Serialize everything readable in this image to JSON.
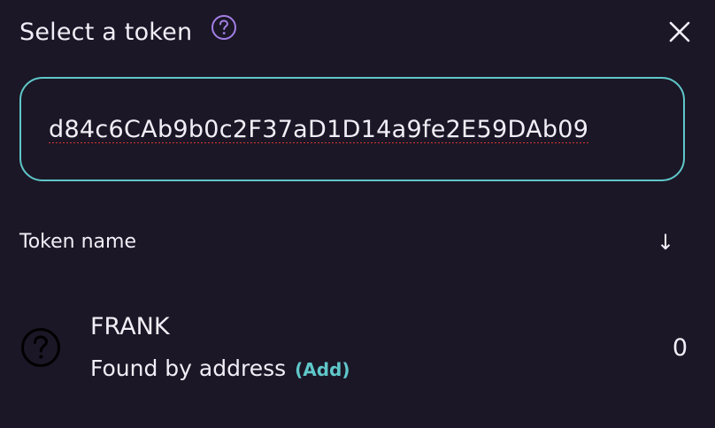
{
  "header": {
    "title": "Select a token",
    "help_icon": "question-circle-icon",
    "close_icon": "close-icon"
  },
  "search": {
    "value": "d84c6CAb9b0c2F37aD1D14a9fe2E59DAb09",
    "placeholder": ""
  },
  "list_header": {
    "label": "Token name",
    "sort_icon": "↓"
  },
  "tokens": [
    {
      "symbol": "FRANK",
      "status": "Found by address",
      "add_label": "(Add)",
      "balance": "0",
      "icon": "question-circle-icon"
    }
  ],
  "colors": {
    "background": "#1b1726",
    "text": "#f1eef7",
    "accent": "#5fc7c9",
    "help_icon": "#a27fe6",
    "spell_error": "#d6362f"
  }
}
